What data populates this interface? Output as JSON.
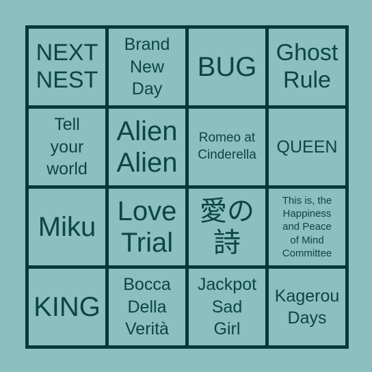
{
  "cells": [
    "NEXT\nNEST",
    "Brand\nNew\nDay",
    "BUG",
    "Ghost\nRule",
    "Tell\nyour\nworld",
    "Alien\nAlien",
    "Romeo at\nCinderella",
    "QUEEN",
    "Miku",
    "Love\nTrial",
    "愛の\n詩",
    "This is, the\nHappiness\nand Peace\nof Mind\nCommittee",
    "KING",
    "Bocca\nDella\nVerità",
    "Jackpot\nSad\nGirl",
    "Kagerou\nDays"
  ],
  "colors": {
    "background": "#8cbfbf",
    "grid": "#063a3a",
    "text": "#0b4545"
  }
}
